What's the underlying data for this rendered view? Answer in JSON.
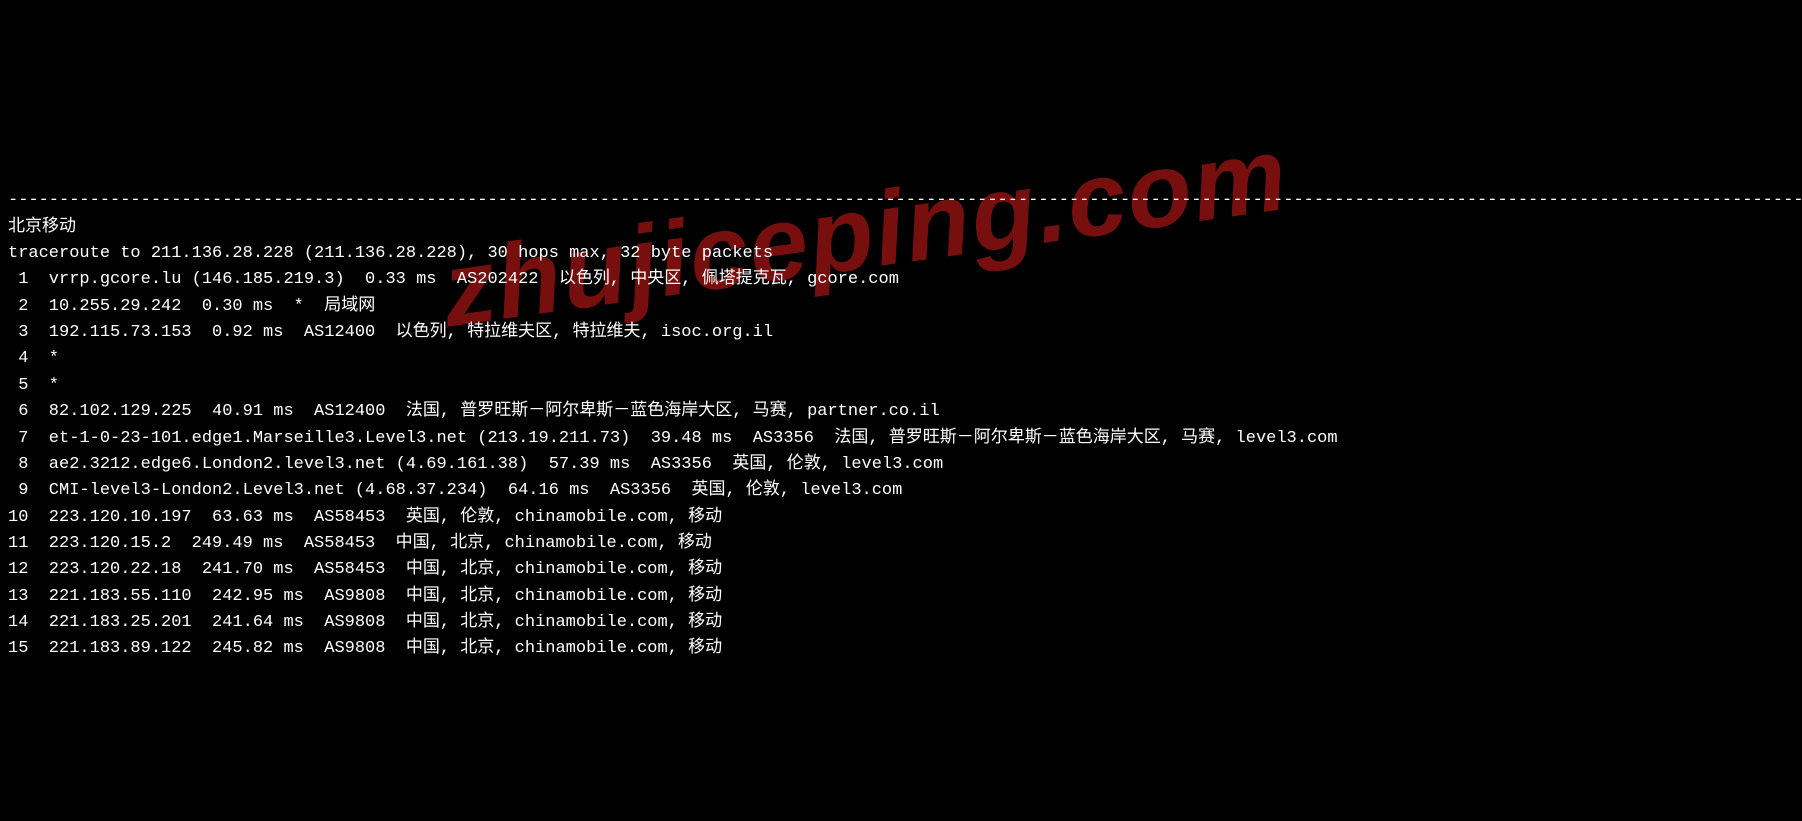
{
  "separator": "--------------------------------------------------------------------------------------------------------------------------------------------------------------------------------",
  "title": "北京移动",
  "traceroute_header": "traceroute to 211.136.28.228 (211.136.28.228), 30 hops max, 32 byte packets",
  "watermark": "zhujiceping.com",
  "hops": [
    {
      "num": " 1",
      "host": "vrrp.gcore.lu (146.185.219.3)",
      "rtt": "0.33 ms",
      "asn": "AS202422",
      "location": "以色列, 中央区, 佩塔提克瓦, gcore.com"
    },
    {
      "num": " 2",
      "host": "10.255.29.242",
      "rtt": "0.30 ms",
      "asn": "*",
      "location": "局域网"
    },
    {
      "num": " 3",
      "host": "192.115.73.153",
      "rtt": "0.92 ms",
      "asn": "AS12400",
      "location": "以色列, 特拉维夫区, 特拉维夫, isoc.org.il"
    },
    {
      "num": " 4",
      "host": "*",
      "rtt": "",
      "asn": "",
      "location": ""
    },
    {
      "num": " 5",
      "host": "*",
      "rtt": "",
      "asn": "",
      "location": ""
    },
    {
      "num": " 6",
      "host": "82.102.129.225",
      "rtt": "40.91 ms",
      "asn": "AS12400",
      "location": "法国, 普罗旺斯－阿尔卑斯－蓝色海岸大区, 马赛, partner.co.il"
    },
    {
      "num": " 7",
      "host": "et-1-0-23-101.edge1.Marseille3.Level3.net (213.19.211.73)",
      "rtt": "39.48 ms",
      "asn": "AS3356",
      "location": "法国, 普罗旺斯－阿尔卑斯－蓝色海岸大区, 马赛, level3.com"
    },
    {
      "num": " 8",
      "host": "ae2.3212.edge6.London2.level3.net (4.69.161.38)",
      "rtt": "57.39 ms",
      "asn": "AS3356",
      "location": "英国, 伦敦, level3.com"
    },
    {
      "num": " 9",
      "host": "CMI-level3-London2.Level3.net (4.68.37.234)",
      "rtt": "64.16 ms",
      "asn": "AS3356",
      "location": "英国, 伦敦, level3.com"
    },
    {
      "num": "10",
      "host": "223.120.10.197",
      "rtt": "63.63 ms",
      "asn": "AS58453",
      "location": "英国, 伦敦, chinamobile.com, 移动"
    },
    {
      "num": "11",
      "host": "223.120.15.2",
      "rtt": "249.49 ms",
      "asn": "AS58453",
      "location": "中国, 北京, chinamobile.com, 移动"
    },
    {
      "num": "12",
      "host": "223.120.22.18",
      "rtt": "241.70 ms",
      "asn": "AS58453",
      "location": "中国, 北京, chinamobile.com, 移动"
    },
    {
      "num": "13",
      "host": "221.183.55.110",
      "rtt": "242.95 ms",
      "asn": "AS9808",
      "location": "中国, 北京, chinamobile.com, 移动"
    },
    {
      "num": "14",
      "host": "221.183.25.201",
      "rtt": "241.64 ms",
      "asn": "AS9808",
      "location": "中国, 北京, chinamobile.com, 移动"
    },
    {
      "num": "15",
      "host": "221.183.89.122",
      "rtt": "245.82 ms",
      "asn": "AS9808",
      "location": "中国, 北京, chinamobile.com, 移动"
    }
  ]
}
